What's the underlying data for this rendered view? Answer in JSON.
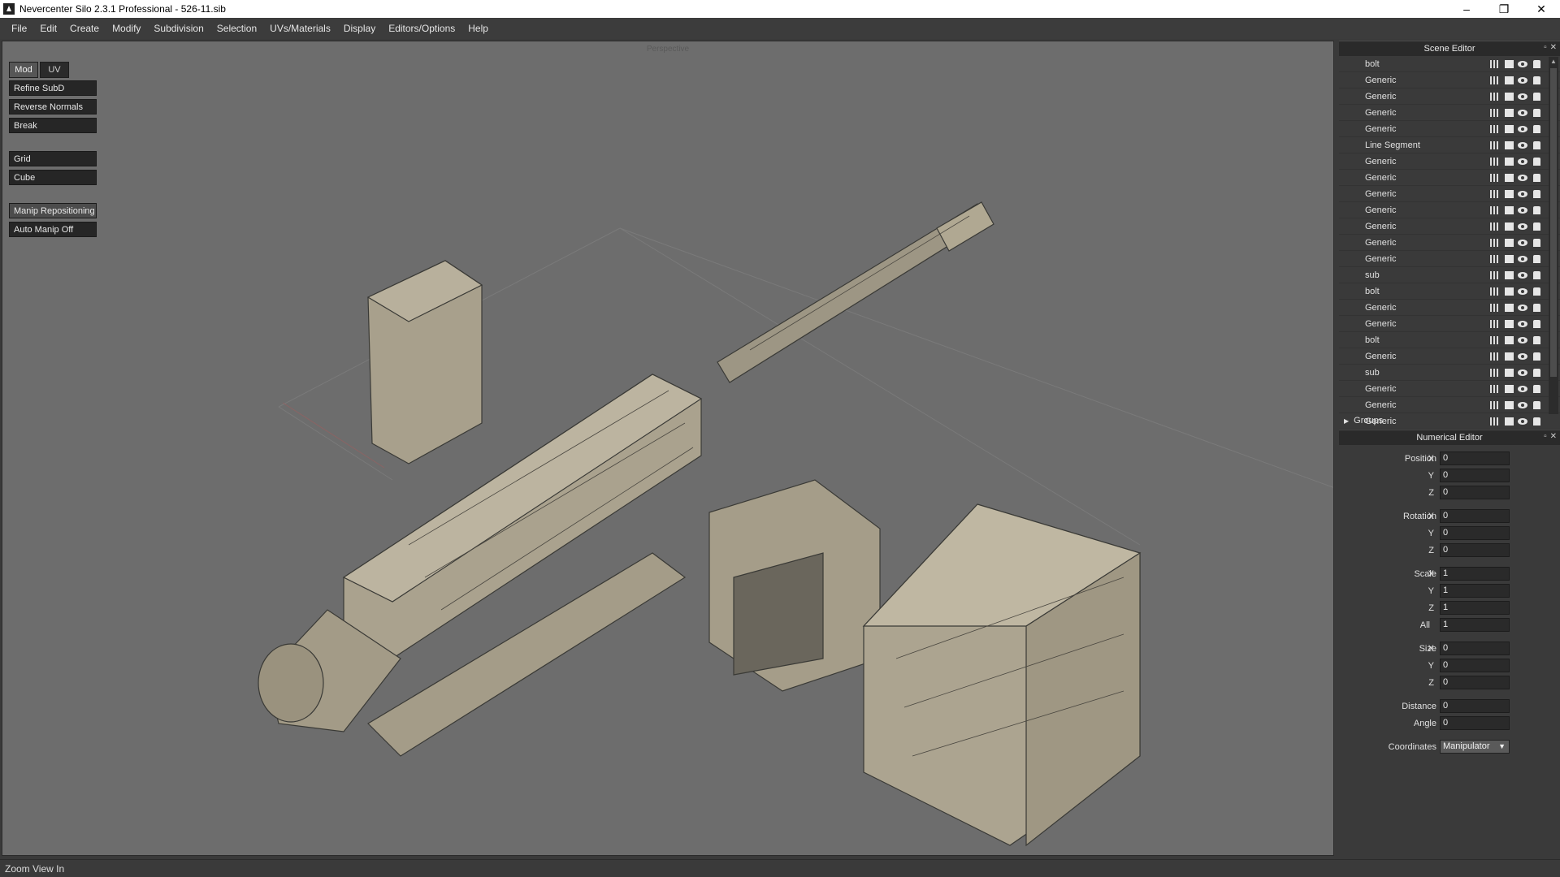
{
  "window": {
    "title": "Nevercenter Silo 2.3.1 Professional - 526-11.sib",
    "buttons": [
      "–",
      "❐",
      "✕"
    ]
  },
  "menu": [
    "File",
    "Edit",
    "Create",
    "Modify",
    "Subdivision",
    "Selection",
    "UVs/Materials",
    "Display",
    "Editors/Options",
    "Help"
  ],
  "viewport": {
    "label": "Perspective"
  },
  "toolbox": {
    "tabs": [
      {
        "label": "Mod",
        "active": true
      },
      {
        "label": "UV",
        "active": false
      }
    ],
    "buttons_top": [
      "Refine SubD",
      "Reverse Normals",
      "Break"
    ],
    "buttons_mid": [
      "Grid",
      "Cube"
    ],
    "buttons_bottom": [
      "Manip Repositioning",
      "Auto Manip Off"
    ]
  },
  "scene_editor": {
    "title": "Scene Editor",
    "objects": [
      "bolt",
      "Generic",
      "Generic",
      "Generic",
      "Generic",
      "Line Segment",
      "Generic",
      "Generic",
      "Generic",
      "Generic",
      "Generic",
      "Generic",
      "Generic",
      "sub",
      "bolt",
      "Generic",
      "Generic",
      "bolt",
      "Generic",
      "sub",
      "Generic",
      "Generic",
      "Generic"
    ],
    "groups_label": "Groups"
  },
  "numerical_editor": {
    "title": "Numerical Editor",
    "position": {
      "label": "Position",
      "x": "0",
      "y": "0",
      "z": "0"
    },
    "rotation": {
      "label": "Rotation",
      "x": "0",
      "y": "0",
      "z": "0"
    },
    "scale": {
      "label": "Scale",
      "x": "1",
      "y": "1",
      "z": "1",
      "all_label": "All",
      "all": "1"
    },
    "size": {
      "label": "Size",
      "x": "0",
      "y": "0",
      "z": "0"
    },
    "distance": {
      "label": "Distance",
      "value": "0"
    },
    "angle": {
      "label": "Angle",
      "value": "0"
    },
    "coordinates": {
      "label": "Coordinates",
      "value": "Manipulator"
    },
    "axes": [
      "X",
      "Y",
      "Z"
    ]
  },
  "status": {
    "text": "Zoom View In"
  },
  "colors": {
    "viewport_bg": "#6d6d6d",
    "model_fill": "#a8a08c",
    "model_edge": "#3a3a36",
    "panel_bg": "#3a3a3a"
  }
}
